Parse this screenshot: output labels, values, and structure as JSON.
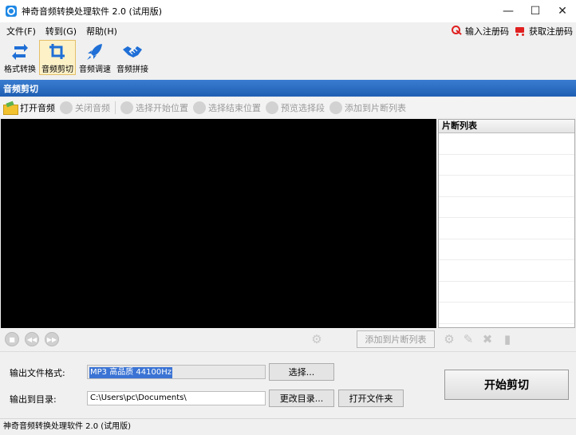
{
  "window": {
    "title": "神奇音频转换处理软件 2.0 (试用版)",
    "minimize": "—",
    "maximize": "☐",
    "close": "✕"
  },
  "menu": {
    "items": [
      "文件(F)",
      "转到(G)",
      "帮助(H)"
    ],
    "register": "输入注册码",
    "buy": "获取注册码"
  },
  "modes": [
    {
      "label": "格式转换",
      "icon": "convert-icon"
    },
    {
      "label": "音频剪切",
      "icon": "crop-icon",
      "active": true
    },
    {
      "label": "音频调速",
      "icon": "rocket-icon"
    },
    {
      "label": "音频拼接",
      "icon": "join-icon"
    }
  ],
  "section": {
    "title": "音频剪切"
  },
  "toolbar": {
    "open": "打开音频",
    "close": "关闭音频",
    "set_start": "选择开始位置",
    "set_end": "选择结束位置",
    "preview": "预览选择段",
    "add": "添加到片断列表"
  },
  "segments": {
    "title": "片断列表"
  },
  "player": {
    "add_button": "添加到片断列表"
  },
  "output": {
    "format_label": "输出文件格式:",
    "format_value": "MP3 高品质 44100Hz",
    "select_button": "选择...",
    "dir_label": "输出到目录:",
    "dir_value": "C:\\Users\\pc\\Documents\\",
    "change_dir_button": "更改目录...",
    "open_folder_button": "打开文件夹",
    "start_button": "开始剪切"
  },
  "status": {
    "text": "神奇音频转换处理软件 2.0 (试用版)"
  }
}
